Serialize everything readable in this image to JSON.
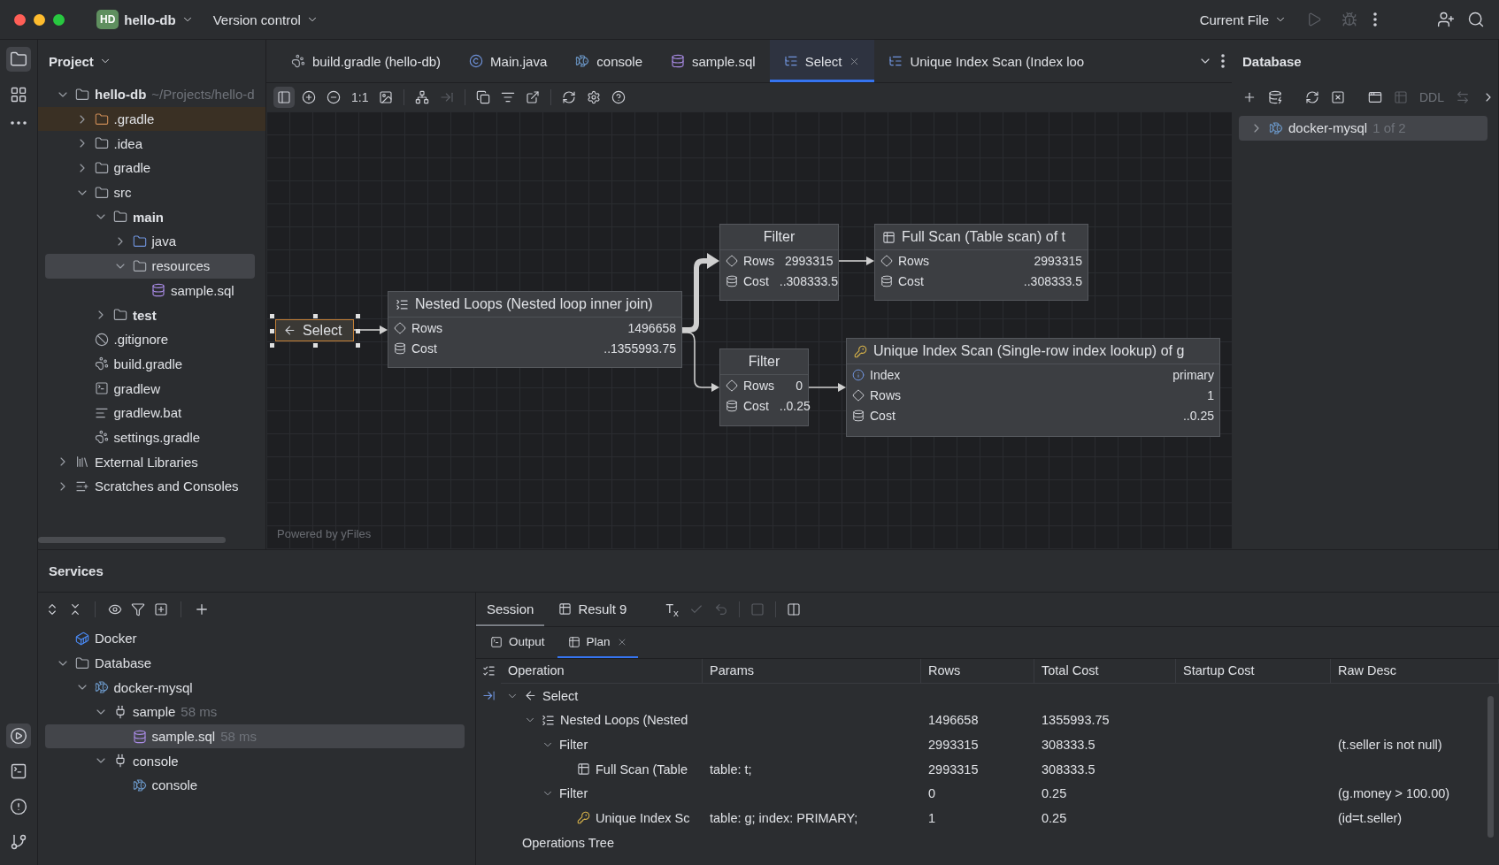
{
  "title_bar": {
    "badge": "HD",
    "project": "hello-db",
    "vcs": "Version control",
    "run_config": "Current File",
    "run_actions": [
      {
        "kind": "run",
        "disabled": true
      },
      {
        "kind": "debug",
        "disabled": true
      }
    ]
  },
  "tool_strip": {
    "top": [
      {
        "kind": "project",
        "selected": true
      },
      {
        "kind": "structure",
        "selected": false
      },
      {
        "kind": "more",
        "selected": false
      }
    ],
    "bottom": [
      {
        "kind": "services",
        "selected": true
      },
      {
        "kind": "terminal",
        "selected": false
      },
      {
        "kind": "problems",
        "selected": false
      },
      {
        "kind": "git",
        "selected": false
      }
    ]
  },
  "project": {
    "title": "Project",
    "tree": [
      {
        "name": "hello-db",
        "path": "~/Projects/hello-d",
        "kind": "module",
        "expanded": true,
        "selected": false,
        "children": [
          {
            "name": ".gradle",
            "kind": "excluded-folder",
            "expanded": false,
            "selected": false
          },
          {
            "name": ".idea",
            "kind": "folder",
            "expanded": false,
            "selected": false
          },
          {
            "name": "gradle",
            "kind": "folder",
            "expanded": false,
            "selected": false
          },
          {
            "name": "src",
            "kind": "folder",
            "expanded": true,
            "selected": false,
            "children": [
              {
                "name": "main",
                "kind": "module",
                "expanded": true,
                "selected": false,
                "children": [
                  {
                    "name": "java",
                    "kind": "source-folder",
                    "expanded": false,
                    "selected": false
                  },
                  {
                    "name": "resources",
                    "kind": "resources-folder",
                    "expanded": true,
                    "selected": true,
                    "children": [
                      {
                        "name": "sample.sql",
                        "kind": "sql",
                        "selected": false
                      }
                    ]
                  }
                ]
              },
              {
                "name": "test",
                "kind": "module",
                "expanded": false,
                "selected": false
              }
            ]
          },
          {
            "name": ".gitignore",
            "kind": "ignore",
            "selected": false
          },
          {
            "name": "build.gradle",
            "kind": "gradle",
            "selected": false
          },
          {
            "name": "gradlew",
            "kind": "terminal",
            "selected": false
          },
          {
            "name": "gradlew.bat",
            "kind": "text",
            "selected": false
          },
          {
            "name": "settings.gradle",
            "kind": "gradle",
            "selected": false
          }
        ]
      },
      {
        "name": "External Libraries",
        "kind": "libraries",
        "expanded": false,
        "selected": false
      },
      {
        "name": "Scratches and Consoles",
        "kind": "scratches",
        "expanded": false,
        "selected": false
      }
    ]
  },
  "editor_tabs": [
    {
      "label": "build.gradle (hello-db)",
      "kind": "gradle",
      "selected": false
    },
    {
      "label": "Main.java",
      "kind": "class",
      "selected": false
    },
    {
      "label": "console",
      "kind": "console",
      "selected": false
    },
    {
      "label": "sample.sql",
      "kind": "sql",
      "selected": false
    },
    {
      "label": "Select",
      "kind": "plan",
      "selected": true
    },
    {
      "label": "Unique Index Scan (Index loo",
      "kind": "plan",
      "selected": false
    }
  ],
  "diagram_toolbar": [
    {
      "kind": "sidebar",
      "on": true,
      "disabled": false
    },
    {
      "kind": "zoom-in",
      "on": false,
      "disabled": false
    },
    {
      "kind": "zoom-out",
      "on": false,
      "disabled": false
    },
    {
      "kind": "actual-size",
      "label": "1:1",
      "on": false,
      "disabled": false
    },
    {
      "kind": "fit",
      "on": false,
      "disabled": false
    },
    {
      "kind": "layout",
      "on": false,
      "disabled": false
    },
    {
      "kind": "align",
      "on": false,
      "disabled": true
    },
    {
      "kind": "copy",
      "on": false,
      "disabled": false
    },
    {
      "kind": "list",
      "on": false,
      "disabled": false
    },
    {
      "kind": "export",
      "on": false,
      "disabled": false
    },
    {
      "kind": "refresh",
      "on": false,
      "disabled": false
    },
    {
      "kind": "settings",
      "on": false,
      "disabled": false
    },
    {
      "kind": "help",
      "on": false,
      "disabled": false
    }
  ],
  "plan_diagram": {
    "credit": "Powered by yFiles",
    "nodes": [
      {
        "kind": "select",
        "title": "Select",
        "selected": true
      },
      {
        "kind": "join",
        "title": "Nested Loops (Nested loop inner join)",
        "selected": false,
        "props": [
          {
            "kind": "rows",
            "label": "Rows",
            "value": "1496658"
          },
          {
            "kind": "cost",
            "label": "Cost",
            "value": "..1355993.75"
          }
        ]
      },
      {
        "kind": "filter",
        "title": "Filter",
        "selected": false,
        "props": [
          {
            "kind": "rows",
            "label": "Rows",
            "value": "2993315"
          },
          {
            "kind": "cost",
            "label": "Cost",
            "value": "..308333.5"
          }
        ]
      },
      {
        "kind": "scan",
        "title": "Full Scan (Table scan) of t",
        "selected": false,
        "props": [
          {
            "kind": "rows",
            "label": "Rows",
            "value": "2993315"
          },
          {
            "kind": "cost",
            "label": "Cost",
            "value": "..308333.5"
          }
        ]
      },
      {
        "kind": "filter",
        "title": "Filter",
        "selected": false,
        "props": [
          {
            "kind": "rows",
            "label": "Rows",
            "value": "0"
          },
          {
            "kind": "cost",
            "label": "Cost",
            "value": "..0.25"
          }
        ]
      },
      {
        "kind": "index",
        "title": "Unique Index Scan (Single-row index lookup) of g",
        "selected": false,
        "props": [
          {
            "kind": "index",
            "label": "Index",
            "value": "primary"
          },
          {
            "kind": "rows",
            "label": "Rows",
            "value": "1"
          },
          {
            "kind": "cost",
            "label": "Cost",
            "value": "..0.25"
          }
        ]
      }
    ]
  },
  "database": {
    "title": "Database",
    "toolbar": [
      {
        "kind": "add",
        "disabled": false
      },
      {
        "kind": "db-settings",
        "disabled": false
      },
      {
        "kind": "refresh",
        "disabled": false
      },
      {
        "kind": "disconnect",
        "disabled": false
      },
      {
        "kind": "console",
        "disabled": false
      },
      {
        "kind": "table",
        "disabled": true
      },
      {
        "kind": "ddl",
        "label": "DDL",
        "disabled": true
      },
      {
        "kind": "compare",
        "disabled": true
      },
      {
        "kind": "more",
        "disabled": false
      }
    ],
    "tree": [
      {
        "name": "docker-mysql",
        "badge": "1 of 2",
        "kind": "mysql",
        "expanded": false,
        "selected": true
      }
    ]
  },
  "services": {
    "title": "Services",
    "tree": [
      {
        "name": "Docker",
        "kind": "docker",
        "selected": false
      },
      {
        "name": "Database",
        "kind": "folder",
        "expanded": true,
        "selected": false,
        "children": [
          {
            "name": "docker-mysql",
            "kind": "mysql",
            "expanded": true,
            "selected": false,
            "children": [
              {
                "name": "sample",
                "time": "58 ms",
                "kind": "session",
                "expanded": true,
                "selected": false,
                "children": [
                  {
                    "name": "sample.sql",
                    "time": "58 ms",
                    "kind": "sql",
                    "selected": true
                  }
                ]
              },
              {
                "name": "console",
                "kind": "session",
                "expanded": true,
                "selected": false,
                "children": [
                  {
                    "name": "console",
                    "kind": "mysql",
                    "selected": false
                  }
                ]
              }
            ]
          }
        ]
      }
    ]
  },
  "results": {
    "tabs": [
      {
        "label": "Session",
        "kind": "session",
        "selected": true
      },
      {
        "label": "Result 9",
        "kind": "table",
        "selected": false
      }
    ],
    "toolbar": [
      {
        "kind": "tx",
        "label": "T$_{x}$",
        "disabled": false
      },
      {
        "kind": "commit",
        "disabled": true
      },
      {
        "kind": "rollback",
        "disabled": true
      },
      {
        "kind": "stop",
        "disabled": true
      },
      {
        "kind": "layout",
        "disabled": false
      }
    ],
    "subtabs": [
      {
        "label": "Output",
        "kind": "output",
        "selected": false
      },
      {
        "label": "Plan",
        "kind": "table",
        "selected": true
      }
    ],
    "columns": [
      "Operation",
      "Params",
      "Rows",
      "Total Cost",
      "Startup Cost",
      "Raw Desc"
    ],
    "rows": [
      {
        "operation": "Select",
        "kind": "select",
        "expanded": true,
        "children": [
          {
            "operation": "Nested Loops (Nested",
            "kind": "join",
            "rows": "1496658",
            "total_cost": "1355993.75",
            "expanded": true,
            "children": [
              {
                "operation": "Filter",
                "rows": "2993315",
                "total_cost": "308333.5",
                "raw_desc": "(t.seller is not null)",
                "expanded": true,
                "children": [
                  {
                    "operation": "Full Scan (Table",
                    "kind": "scan",
                    "params": "table: t;",
                    "rows": "2993315",
                    "total_cost": "308333.5"
                  }
                ]
              },
              {
                "operation": "Filter",
                "rows": "0",
                "total_cost": "0.25",
                "raw_desc": "(g.money > 100.00)",
                "expanded": true,
                "children": [
                  {
                    "operation": "Unique Index Sc",
                    "kind": "index",
                    "params": "table: g; index: PRIMARY;",
                    "rows": "1",
                    "total_cost": "0.25",
                    "raw_desc": "(id=t.seller)"
                  }
                ]
              }
            ]
          }
        ]
      }
    ],
    "footer": "Operations Tree"
  }
}
